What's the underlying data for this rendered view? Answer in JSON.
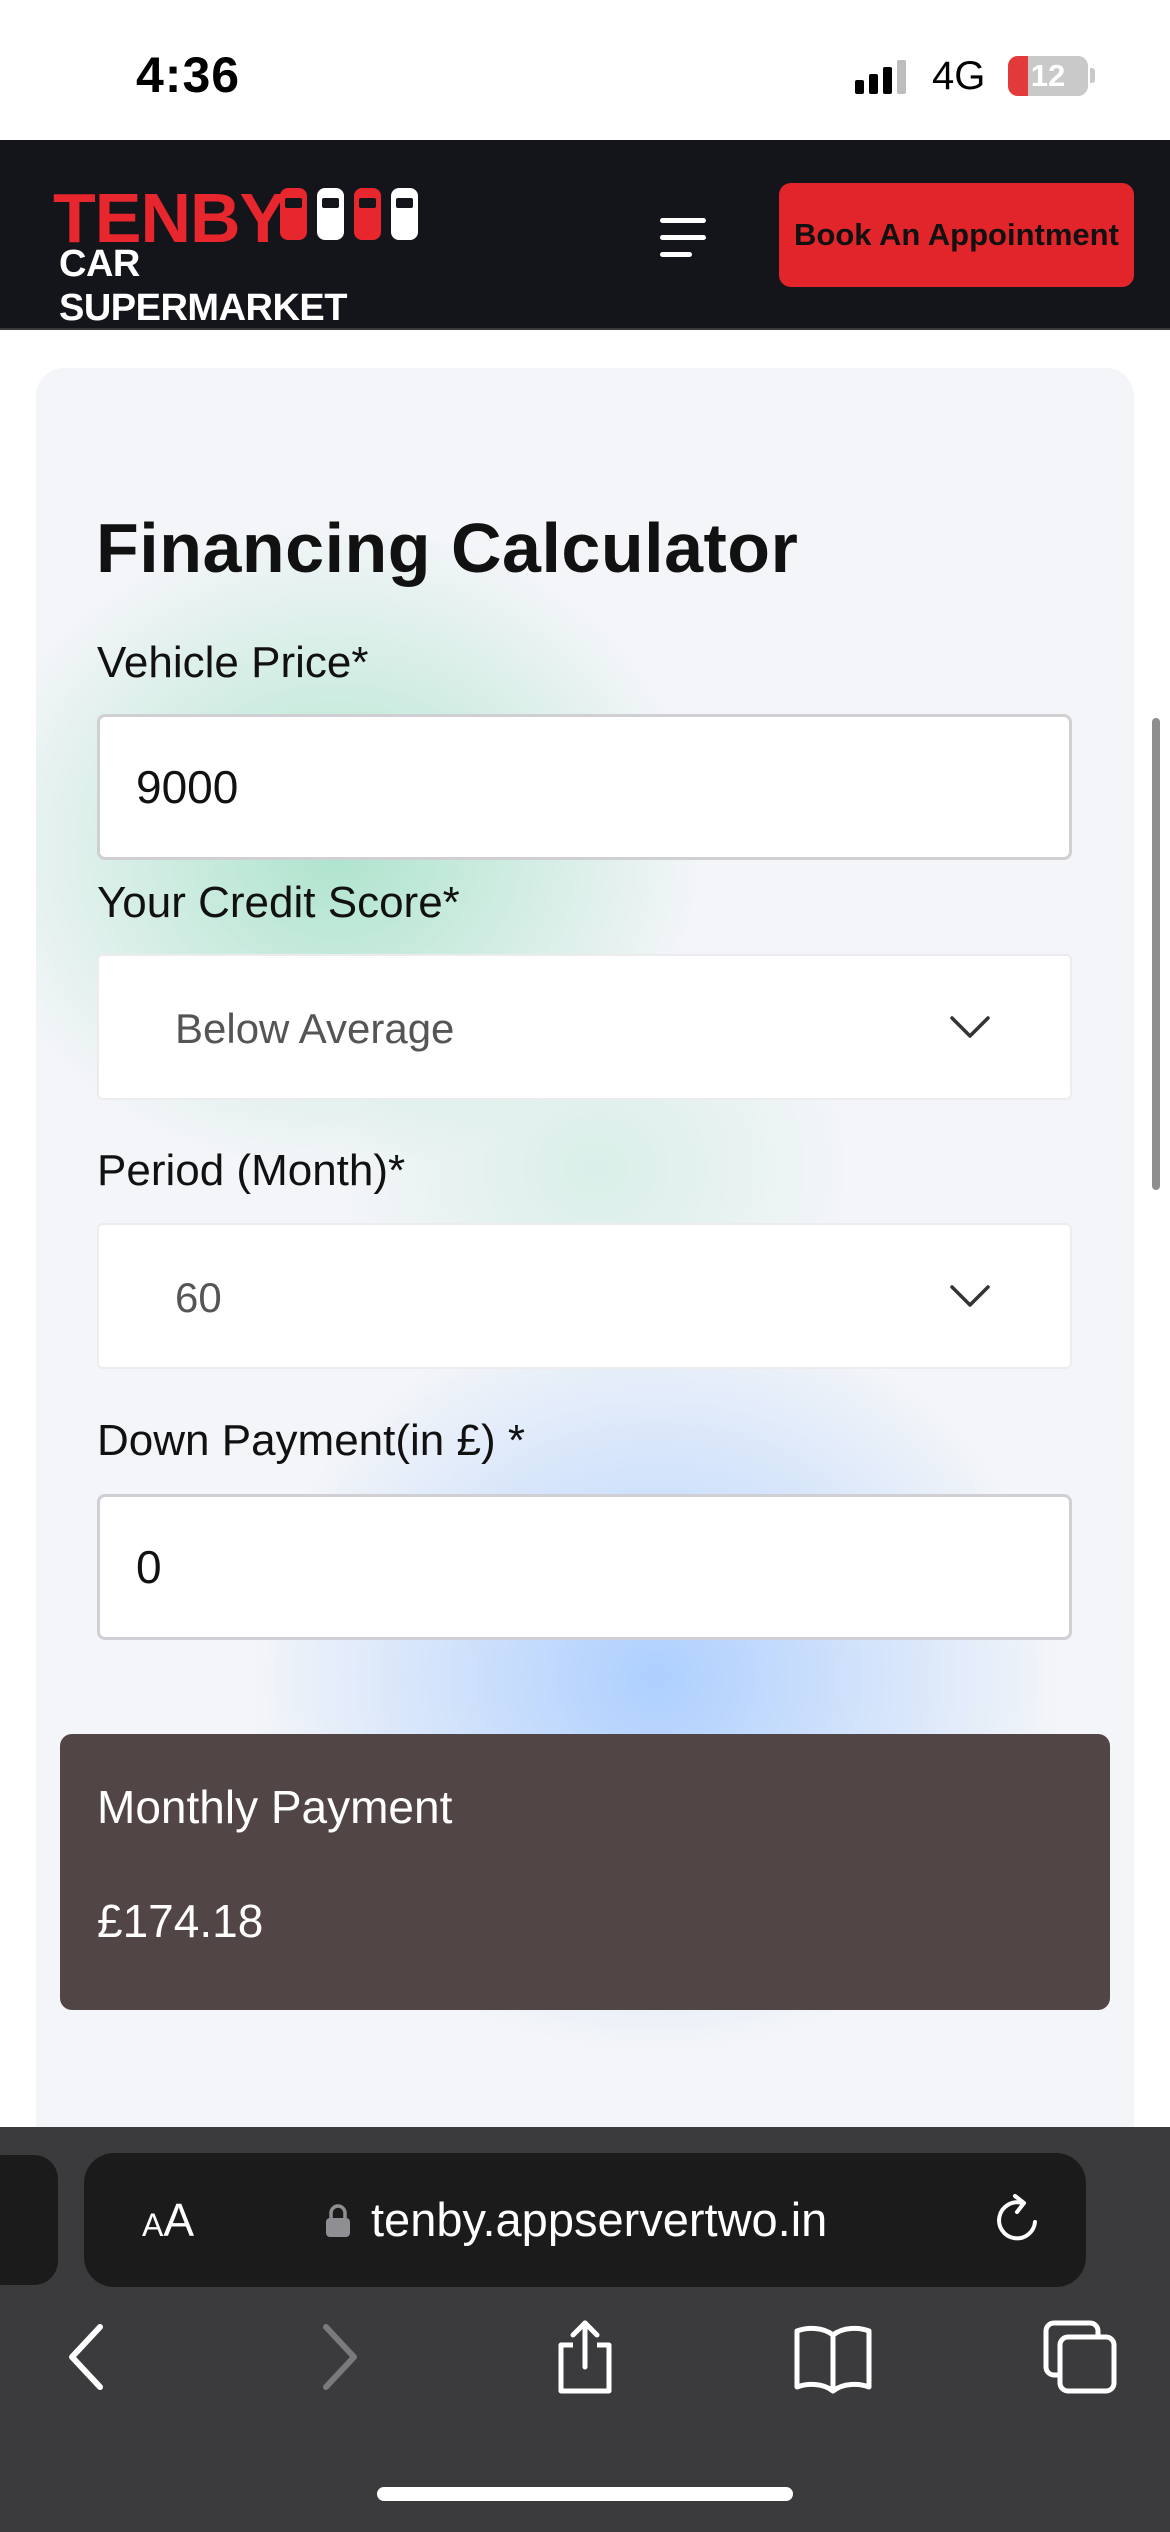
{
  "status_bar": {
    "time": "4:36",
    "network": "4G",
    "battery_level": "12"
  },
  "header": {
    "logo_line1": "TENBY",
    "logo_line2": "CAR SUPERMARKET",
    "book_button_label": "Book An Appointment",
    "brand_color": "#e2252b",
    "background_color": "#14151b"
  },
  "calculator": {
    "title": "Financing Calculator",
    "vehicle_price_label": "Vehicle Price*",
    "vehicle_price_value": "9000",
    "credit_score_label": "Your Credit Score*",
    "credit_score_value": "Below Average",
    "period_label": "Period (Month)*",
    "period_value": "60",
    "down_payment_label": "Down Payment(in £) *",
    "down_payment_value": "0",
    "result_label": "Monthly Payment",
    "result_value": "£174.18",
    "result_background": "#524546"
  },
  "browser": {
    "text_size_small": "A",
    "text_size_big": "A",
    "url": "tenby.appservertwo.in",
    "icons": [
      "lock-icon",
      "reload-icon",
      "back-icon",
      "forward-icon",
      "share-icon",
      "bookmarks-icon",
      "tabs-icon"
    ]
  }
}
